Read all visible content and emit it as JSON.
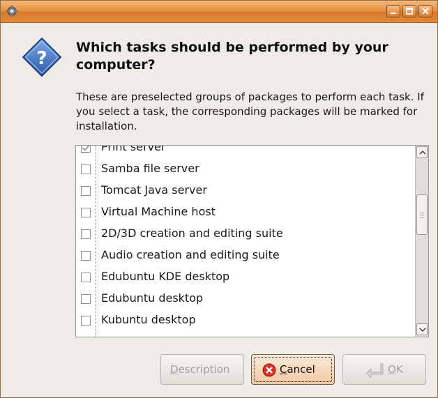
{
  "window": {
    "title": "",
    "controls": {
      "minimize": "minimize-icon",
      "maximize": "maximize-icon",
      "close": "close-icon"
    }
  },
  "dialog": {
    "heading": "Which tasks should be performed by your computer?",
    "description": "These are preselected groups of packages to perform each task. If you select a task, the corresponding packages will be marked for installation."
  },
  "tasks": [
    {
      "label": "Print server",
      "checked": true
    },
    {
      "label": "Samba file server",
      "checked": false
    },
    {
      "label": "Tomcat Java server",
      "checked": false
    },
    {
      "label": "Virtual Machine host",
      "checked": false
    },
    {
      "label": "2D/3D creation and editing suite",
      "checked": false
    },
    {
      "label": "Audio creation and editing suite",
      "checked": false
    },
    {
      "label": "Edubuntu KDE desktop",
      "checked": false
    },
    {
      "label": "Edubuntu desktop",
      "checked": false
    },
    {
      "label": "Kubuntu desktop",
      "checked": false
    }
  ],
  "buttons": {
    "description": {
      "mnemonic": "D",
      "rest": "escription",
      "enabled": false
    },
    "cancel": {
      "mnemonic": "C",
      "rest": "ancel",
      "enabled": true
    },
    "ok": {
      "mnemonic": "O",
      "rest": "K",
      "enabled": false
    }
  },
  "colors": {
    "titlebar": "#e58f3f",
    "question_icon": "#3b6fc1",
    "cancel_icon": "#d93025"
  }
}
